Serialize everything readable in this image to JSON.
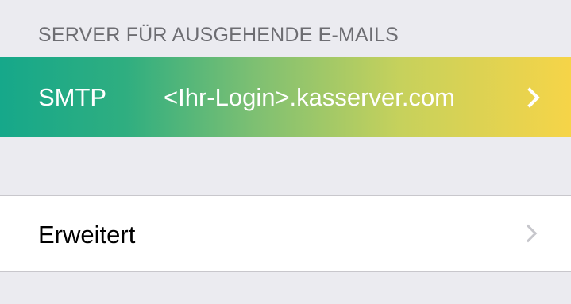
{
  "outgoing_server": {
    "section_header": "SERVER FÜR AUSGEHENDE E-MAILS",
    "smtp_row": {
      "label": "SMTP",
      "value": "<Ihr-Login>.kasserver.com",
      "chevron_icon": "chevron-right-icon"
    },
    "advanced_row": {
      "label": "Erweitert",
      "chevron_icon": "chevron-right-icon"
    }
  },
  "colors": {
    "background": "#ebebf0",
    "section_header_text": "#6d6d72",
    "highlight_gradient_start": "#16a88a",
    "highlight_gradient_end": "#f6d448",
    "highlight_text": "#ffffff",
    "row_background": "#ffffff",
    "separator": "#c8c7cc",
    "chevron_gray": "#c7c7cc"
  }
}
